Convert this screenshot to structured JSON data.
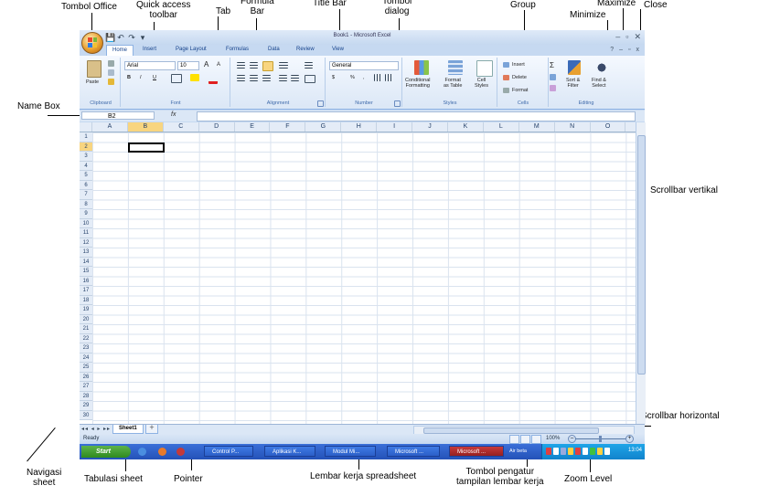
{
  "annotations": {
    "tombol_office": "Tombol Office",
    "quick_access_toolbar": "Quick access\ntoolbar",
    "tab": "Tab",
    "formula_bar": "Formula\nBar",
    "title_bar": "Title Bar",
    "tombol_dialog": "Tombol\ndialog",
    "group": "Group",
    "maximize": "Maximize",
    "minimize": "Minimize",
    "close": "Close",
    "name_box": "Name Box",
    "scrollbar_vertikal": "Scrollbar vertikal",
    "scrollbar_horizontal": "Scrollbar horizontal",
    "navigasi_sheet": "Navigasi\nsheet",
    "tabulasi_sheet": "Tabulasi sheet",
    "pointer": "Pointer",
    "lembar_kerja": "Lembar kerja spreadsheet",
    "tombol_pengatur": "Tombol pengatur\ntampilan lembar kerja",
    "zoom_level": "Zoom Level"
  },
  "window": {
    "title": "Book1 - Microsoft Excel",
    "minimize_glyph": "–",
    "maximize_glyph": "▫",
    "close_glyph": "✕"
  },
  "qat": [
    "💾",
    "↶",
    "↷",
    "▾"
  ],
  "tabs": [
    "Home",
    "Insert",
    "Page Layout",
    "Formulas",
    "Data",
    "Review",
    "View"
  ],
  "ribbon_right": [
    "?",
    "–",
    "▫",
    "x"
  ],
  "ribbon": {
    "clipboard": {
      "paste": "Paste",
      "label": "Clipboard"
    },
    "font": {
      "name": "Arial",
      "size": "10",
      "bold": "B",
      "italic": "I",
      "underline": "U",
      "grow": "A",
      "shrink": "A",
      "label": "Font"
    },
    "alignment": {
      "label": "Alignment"
    },
    "number": {
      "format": "General",
      "currency": "$",
      "percent": "%",
      "comma": ",",
      "label": "Number"
    },
    "styles": {
      "conditional": "Conditional\nFormatting",
      "format_table": "Format\nas Table",
      "cell_styles": "Cell\nStyles",
      "label": "Styles"
    },
    "cells": {
      "insert": "Insert",
      "delete": "Delete",
      "format": "Format",
      "label": "Cells"
    },
    "editing": {
      "sigma": "Σ",
      "sort": "Sort &\nFilter",
      "find": "Find &\nSelect",
      "label": "Editing"
    }
  },
  "formula_bar": {
    "name_box_value": "B2",
    "fx": "fx",
    "value": ""
  },
  "columns": [
    "A",
    "B",
    "C",
    "D",
    "E",
    "F",
    "G",
    "H",
    "I",
    "J",
    "K",
    "L",
    "M",
    "N",
    "O"
  ],
  "rows": [
    "1",
    "2",
    "3",
    "4",
    "5",
    "6",
    "7",
    "8",
    "9",
    "10",
    "11",
    "12",
    "13",
    "14",
    "15",
    "16",
    "17",
    "18",
    "19",
    "20",
    "21",
    "22",
    "23",
    "24",
    "25",
    "26",
    "27",
    "28",
    "29",
    "30"
  ],
  "selected_column": "B",
  "selected_row": "2",
  "sheet_tabs": {
    "nav": "◂◂ ◂ ▸ ▸▸",
    "sheet": "Sheet1"
  },
  "status": {
    "ready": "Ready",
    "zoom": "100%",
    "minus": "–",
    "plus": "+"
  },
  "zoom_level": 1.0,
  "taskbar": {
    "start": "Start",
    "items": [
      "Control P...",
      "Aplikasi K...",
      "Modul Mi...",
      "Microsoft ...",
      "Microsoft ..."
    ],
    "tray_lang": "Air beta",
    "clock": "13:04"
  },
  "colors": {
    "ribbon_bg": "#dbe7f6",
    "selected_header": "#f8d580",
    "taskbar": "#2452b8",
    "start": "#2f8a1e"
  }
}
